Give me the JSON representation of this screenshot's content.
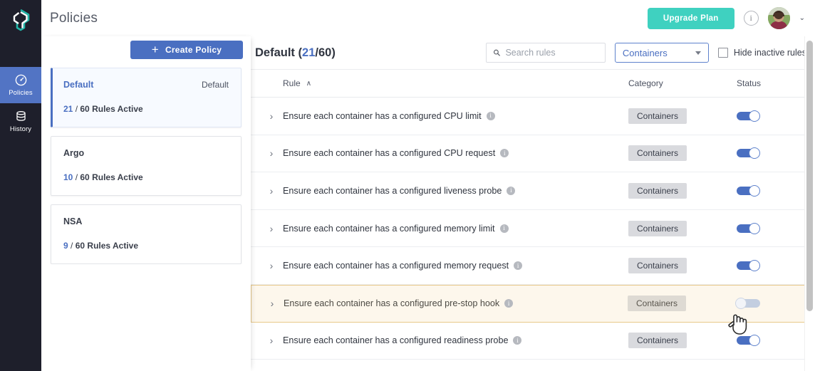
{
  "brand": {
    "logo_name": "fairwinds-logo",
    "accent_blue": "#4a6fc1",
    "accent_teal": "#3fd1c0",
    "highlight_amber": "#fdf7ec"
  },
  "rail": {
    "items": [
      {
        "label": "Policies",
        "icon": "gauge-icon",
        "active": true
      },
      {
        "label": "History",
        "icon": "database-icon",
        "active": false
      }
    ]
  },
  "topbar": {
    "title": "Policies",
    "upgrade_label": "Upgrade Plan",
    "info_glyph": "i",
    "chevron_glyph": "⌄"
  },
  "policies_panel": {
    "create_label": "Create Policy",
    "create_plus": "+",
    "cards": [
      {
        "name": "Default",
        "tag": "Default",
        "active": 21,
        "total": 60,
        "suffix": "Rules Active",
        "selected": true
      },
      {
        "name": "Argo",
        "tag": "",
        "active": 10,
        "total": 60,
        "suffix": "Rules Active",
        "selected": false
      },
      {
        "name": "NSA",
        "tag": "",
        "active": 9,
        "total": 60,
        "suffix": "Rules Active",
        "selected": false
      }
    ]
  },
  "rules_panel": {
    "title_name": "Default",
    "title_open": " (",
    "title_active": "21",
    "title_sep": "/",
    "title_total": "60",
    "title_close": ")",
    "search_placeholder": "Search rules",
    "search_value": "",
    "filter_selected": "Containers",
    "hide_inactive_label": "Hide inactive rules",
    "hide_inactive_checked": false,
    "columns": {
      "rule": "Rule",
      "sort_caret": "∧",
      "category": "Category",
      "status": "Status"
    },
    "rows": [
      {
        "name": "Ensure each container has a configured CPU limit",
        "category": "Containers",
        "enabled": true,
        "highlighted": false,
        "expander": "›",
        "info": "i"
      },
      {
        "name": "Ensure each container has a configured CPU request",
        "category": "Containers",
        "enabled": true,
        "highlighted": false,
        "expander": "›",
        "info": "i"
      },
      {
        "name": "Ensure each container has a configured liveness probe",
        "category": "Containers",
        "enabled": true,
        "highlighted": false,
        "expander": "›",
        "info": "i"
      },
      {
        "name": "Ensure each container has a configured memory limit",
        "category": "Containers",
        "enabled": true,
        "highlighted": false,
        "expander": "›",
        "info": "i"
      },
      {
        "name": "Ensure each container has a configured memory request",
        "category": "Containers",
        "enabled": true,
        "highlighted": false,
        "expander": "›",
        "info": "i"
      },
      {
        "name": "Ensure each container has a configured pre-stop hook",
        "category": "Containers",
        "enabled": false,
        "highlighted": true,
        "expander": "›",
        "info": "i"
      },
      {
        "name": "Ensure each container has a configured readiness probe",
        "category": "Containers",
        "enabled": true,
        "highlighted": false,
        "expander": "›",
        "info": "i"
      }
    ]
  }
}
